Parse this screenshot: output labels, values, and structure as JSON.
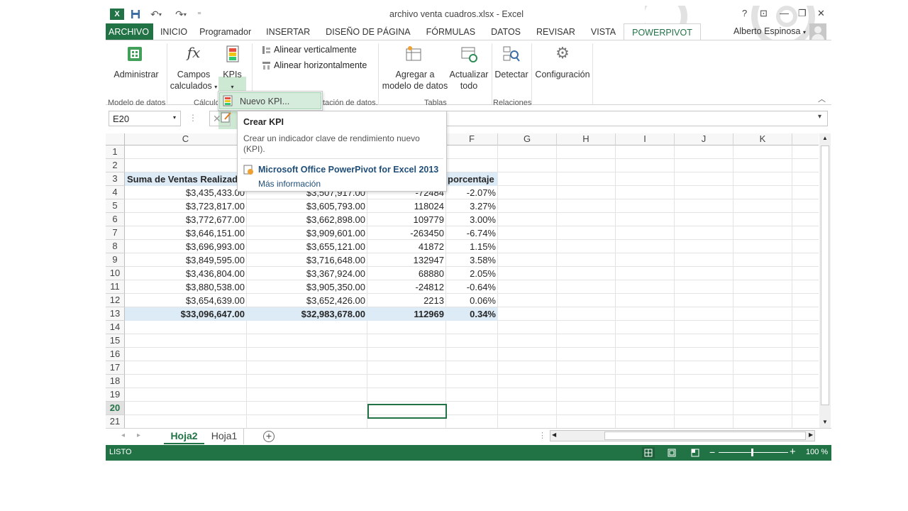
{
  "window": {
    "title": "archivo venta cuadros.xlsx - Excel",
    "controls": {
      "help": "?",
      "restore_ribbon": "⊡",
      "minimize": "—",
      "restore": "❐",
      "close": "✕"
    }
  },
  "qat": {
    "excel_icon": "excel-icon",
    "save_icon": "save-icon",
    "undo_icon": "undo-icon",
    "redo_icon": "redo-icon",
    "customize": "⁼"
  },
  "tabs": [
    "ARCHIVO",
    "INICIO",
    "Programador",
    "INSERTAR",
    "DISEÑO DE PÁGINA",
    "FÓRMULAS",
    "DATOS",
    "REVISAR",
    "VISTA",
    "POWERPIVOT"
  ],
  "user": {
    "name": "Alberto Espinosa"
  },
  "ribbon": {
    "groups": {
      "modelo": "Modelo de datos",
      "calculos": "Cálculo",
      "presentacion": "tación de datos.",
      "tablas": "Tablas",
      "relaciones": "Relaciones"
    },
    "buttons": {
      "administrar": "Administrar",
      "campos_1": "Campos",
      "campos_2": "calculados",
      "kpis": "KPIs",
      "alinear_v": "Alinear verticalmente",
      "alinear_h": "Alinear horizontalmente",
      "agregar_1": "Agregar a",
      "agregar_2": "modelo de datos",
      "actualizar_1": "Actualizar",
      "actualizar_2": "todo",
      "detectar": "Detectar",
      "configuracion": "Configuración"
    }
  },
  "kpi_menu": {
    "nuevo": "Nuevo KPI..."
  },
  "tooltip": {
    "title": "Crear KPI",
    "desc_1": "Crear un indicador clave de rendimiento nuevo",
    "desc_2": "(KPI).",
    "product": "Microsoft Office PowerPivot for Excel 2013",
    "more": "Más información"
  },
  "formula_bar": {
    "name_box": "E20",
    "value": ""
  },
  "columns": [
    "C",
    "F",
    "G",
    "H",
    "I",
    "J",
    "K"
  ],
  "rows": [
    "1",
    "2",
    "3",
    "4",
    "5",
    "6",
    "7",
    "8",
    "9",
    "10",
    "11",
    "12",
    "13",
    "14",
    "15",
    "16",
    "17",
    "18",
    "19",
    "20",
    "21"
  ],
  "header_row": {
    "c": "Suma de Ventas Realizadas",
    "f": "porcentaje"
  },
  "data_rows": [
    {
      "c": "$3,435,433.00",
      "d": "$3,507,917.00",
      "e": "-72484",
      "f": "-2.07%"
    },
    {
      "c": "$3,723,817.00",
      "d": "$3,605,793.00",
      "e": "118024",
      "f": "3.27%"
    },
    {
      "c": "$3,772,677.00",
      "d": "$3,662,898.00",
      "e": "109779",
      "f": "3.00%"
    },
    {
      "c": "$3,646,151.00",
      "d": "$3,909,601.00",
      "e": "-263450",
      "f": "-6.74%"
    },
    {
      "c": "$3,696,993.00",
      "d": "$3,655,121.00",
      "e": "41872",
      "f": "1.15%"
    },
    {
      "c": "$3,849,595.00",
      "d": "$3,716,648.00",
      "e": "132947",
      "f": "3.58%"
    },
    {
      "c": "$3,436,804.00",
      "d": "$3,367,924.00",
      "e": "68880",
      "f": "2.05%"
    },
    {
      "c": "$3,880,538.00",
      "d": "$3,905,350.00",
      "e": "-24812",
      "f": "-0.64%"
    },
    {
      "c": "$3,654,639.00",
      "d": "$3,652,426.00",
      "e": "2213",
      "f": "0.06%"
    }
  ],
  "total_row": {
    "c": "$33,096,647.00",
    "d": "$32,983,678.00",
    "e": "112969",
    "f": "0.34%"
  },
  "sheets": {
    "active": "Hoja2",
    "other": "Hoja1",
    "add": "+"
  },
  "status": {
    "mode": "LISTO",
    "zoom": "100 %",
    "zoom_out": "−",
    "zoom_in": "+"
  },
  "colors": {
    "accent": "#217346",
    "header_band": "#ddebf7",
    "selection_ribbon": "#cde8d3",
    "tooltip_link": "#1f4e79"
  }
}
